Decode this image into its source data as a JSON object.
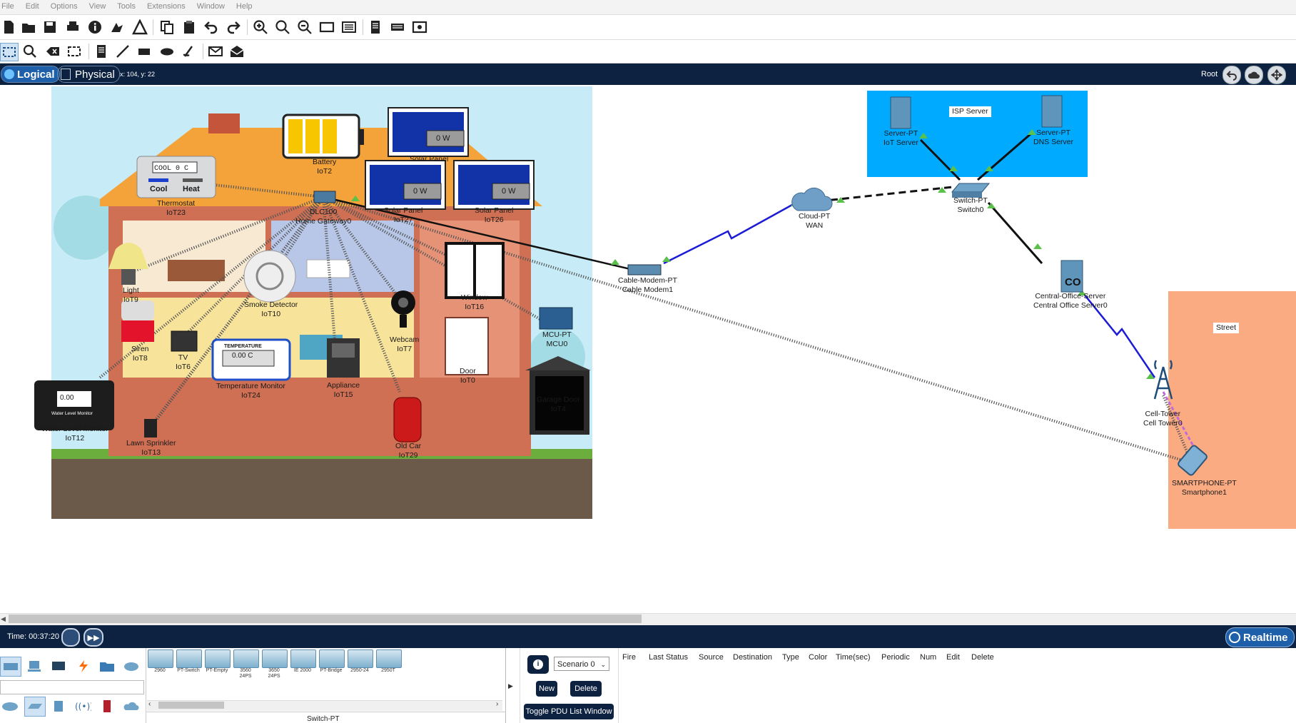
{
  "menu": [
    "File",
    "Edit",
    "Options",
    "View",
    "Tools",
    "Extensions",
    "Window",
    "Help"
  ],
  "modes": {
    "logical": "Logical",
    "physical": "Physical"
  },
  "coordinates": "x: 104, y: 22",
  "root_label": "Root",
  "time": "Time: 00:37:20",
  "realtime_label": "Realtime",
  "workspace": {
    "areas": {
      "isp": "ISP Server",
      "street": "Street"
    },
    "devices": {
      "thermostat": {
        "type": "Thermostat",
        "name": "IoT23",
        "display": "COOL  0 C",
        "cool": "Cool",
        "heat": "Heat"
      },
      "battery": {
        "type": "Battery",
        "name": "IoT2"
      },
      "solar_top": {
        "type": "Solar Panel",
        "name": "",
        "value": "0 W"
      },
      "solar_mid": {
        "type": "Solar Panel",
        "name": "IoT27",
        "value": "0 W"
      },
      "solar_right": {
        "type": "Solar Panel",
        "name": "IoT26",
        "value": "0 W"
      },
      "gateway": {
        "type": "DLC100",
        "name": "Home Gateway0"
      },
      "light": {
        "type": "Light",
        "name": "IoT9"
      },
      "smoke": {
        "type": "Smoke Detector",
        "name": "IoT10"
      },
      "window": {
        "type": "Window",
        "name": "IoT16"
      },
      "siren": {
        "type": "Siren",
        "name": "IoT8"
      },
      "tv": {
        "type": "TV",
        "name": "IoT6"
      },
      "temp_monitor": {
        "type": "Temperature Monitor",
        "name": "IoT24",
        "header": "TEMPERATURE",
        "value": "0.00 C"
      },
      "appliance": {
        "type": "Appliance",
        "name": "IoT15"
      },
      "webcam": {
        "type": "Webcam",
        "name": "IoT7"
      },
      "door": {
        "type": "Door",
        "name": "IoT0"
      },
      "mcu": {
        "type": "MCU-PT",
        "name": "MCU0"
      },
      "garage": {
        "type": "Garage Door",
        "name": "IoT4"
      },
      "water": {
        "type": "Water Level Monitor",
        "name": "IoT12",
        "value": "0.00",
        "caption": "Water Level Monitor"
      },
      "sprinkler": {
        "type": "Lawn Sprinkler",
        "name": "IoT13"
      },
      "old_car": {
        "type": "Old Car",
        "name": "IoT29"
      },
      "cable_modem": {
        "type": "Cable-Modem-PT",
        "name": "Cable Modem1"
      },
      "cloud": {
        "type": "Cloud-PT",
        "name": "WAN"
      },
      "switch": {
        "type": "Switch-PT",
        "name": "Switch0"
      },
      "iot_server": {
        "type": "Server-PT",
        "name": "IoT Server"
      },
      "dns_server": {
        "type": "Server-PT",
        "name": "DNS Server"
      },
      "co_server": {
        "type": "Central-Office-Server",
        "name": "Central Office Server0",
        "glyph": "CO"
      },
      "cell_tower": {
        "type": "Cell-Tower",
        "name": "Cell Tower0"
      },
      "smartphone": {
        "type": "SMARTPHONE-PT",
        "name": "Smartphone1"
      }
    }
  },
  "device_panel": {
    "subtypes": [
      {
        "label": "2960"
      },
      {
        "label": "PT-Switch"
      },
      {
        "label": "PT-Empty"
      },
      {
        "label": "3560 24PS"
      },
      {
        "label": "3650 24PS"
      },
      {
        "label": "IE 2000"
      },
      {
        "label": "PT-Bridge"
      },
      {
        "label": "2950-24"
      },
      {
        "label": "2950T"
      }
    ],
    "selected_name": "Switch-PT"
  },
  "pdu": {
    "scenario": "Scenario 0",
    "new_label": "New",
    "delete_label": "Delete",
    "toggle_label": "Toggle PDU List Window",
    "columns": [
      "Fire",
      "Last Status",
      "Source",
      "Destination",
      "Type",
      "Color",
      "Time(sec)",
      "Periodic",
      "Num",
      "Edit",
      "Delete"
    ]
  },
  "colors": {
    "dark_bar": "#0d2240",
    "isp_area": "#00aaff",
    "street_area": "#fbab82",
    "sky": "#c7ecf7"
  }
}
